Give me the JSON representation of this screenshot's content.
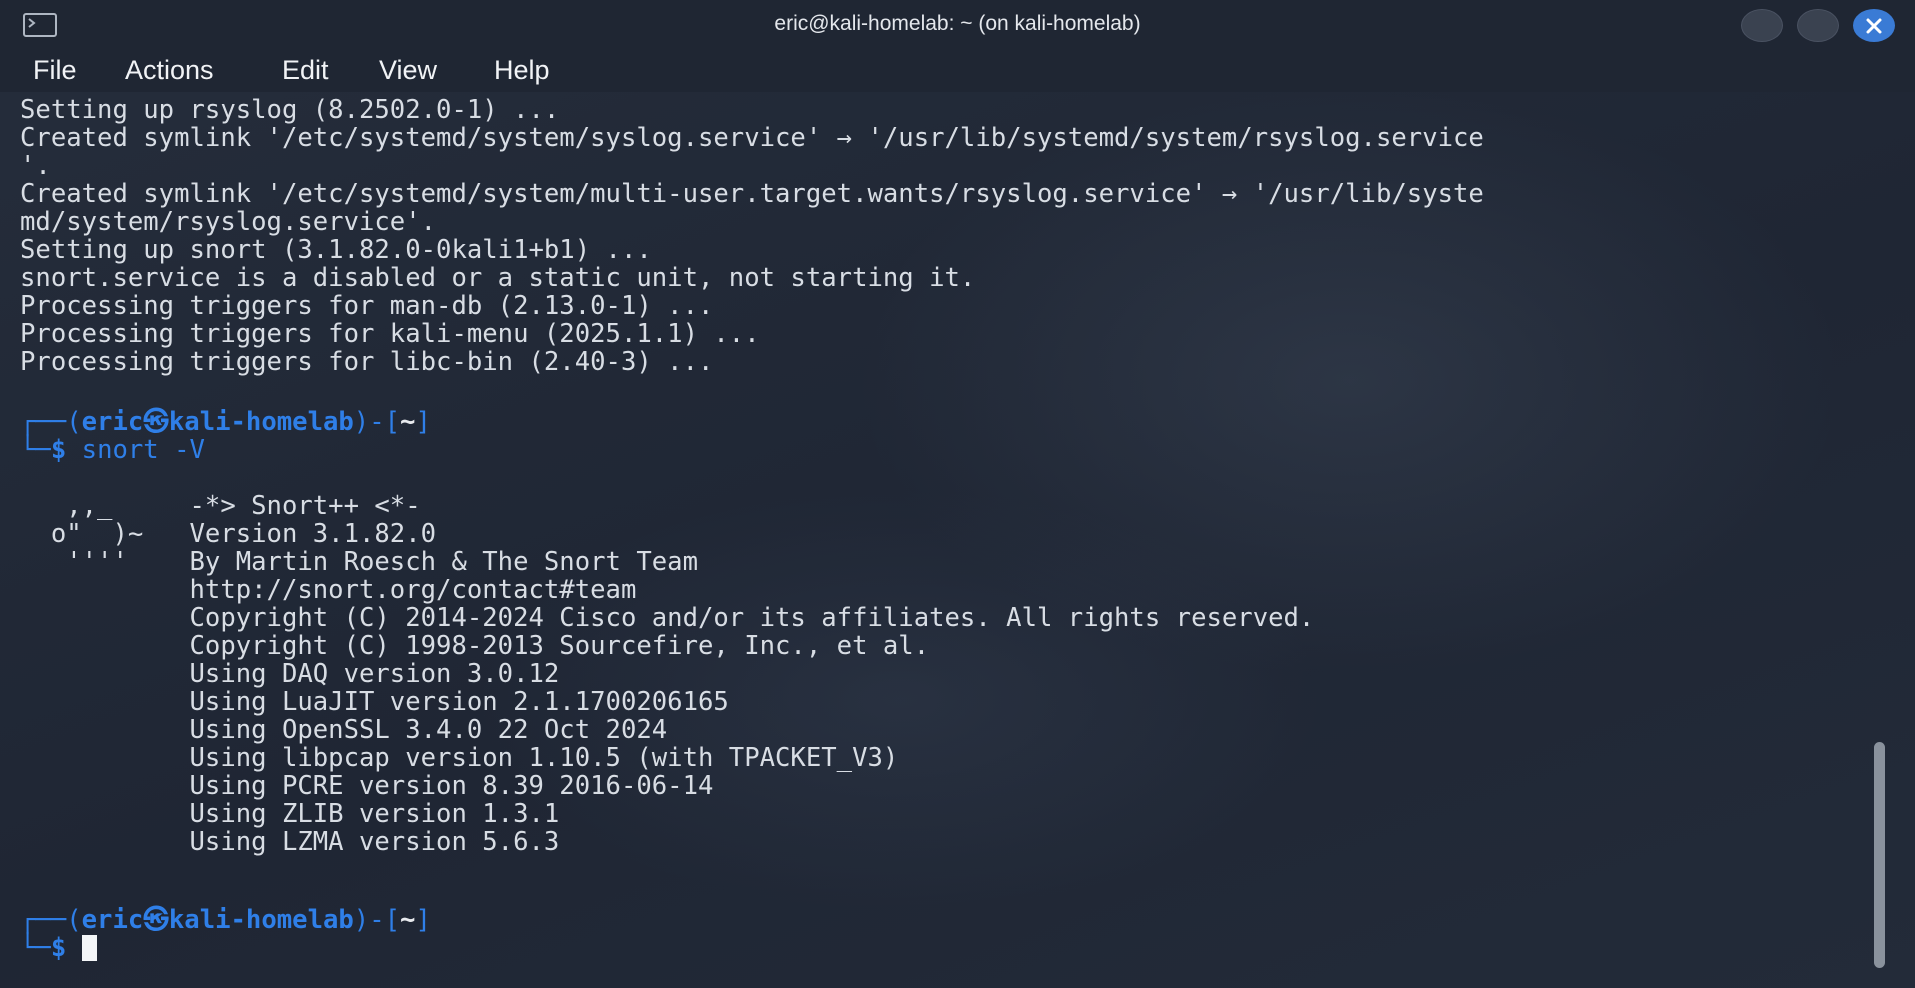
{
  "window": {
    "title": "eric@kali-homelab: ~ (on kali-homelab)",
    "accent_color": "#3a7bd5"
  },
  "menu": {
    "items": [
      "File",
      "Actions",
      "Edit",
      "View",
      "Help"
    ]
  },
  "terminal": {
    "lines": [
      "Setting up rsyslog (8.2502.0-1) ...",
      "Created symlink '/etc/systemd/system/syslog.service' → '/usr/lib/systemd/system/rsyslog.service",
      "'.",
      "Created symlink '/etc/systemd/system/multi-user.target.wants/rsyslog.service' → '/usr/lib/syste",
      "md/system/rsyslog.service'.",
      "Setting up snort (3.1.82.0-0kali1+b1) ...",
      "snort.service is a disabled or a static unit, not starting it.",
      "Processing triggers for man-db (2.13.0-1) ...",
      "Processing triggers for kali-menu (2025.1.1) ...",
      "Processing triggers for libc-bin (2.40-3) ..."
    ],
    "prompt1": {
      "open": "┌──(",
      "user": "eric",
      "at": "㉿",
      "host": "kali-homelab",
      "close": ")-[",
      "cwd": "~",
      "end": "]",
      "prefix": "└─",
      "dollar": "$",
      "command": " snort -V"
    },
    "banner": [
      "   ,,_     -*> Snort++ <*-",
      "  o\"  )~   Version 3.1.82.0",
      "   ''''    By Martin Roesch & The Snort Team",
      "           http://snort.org/contact#team",
      "           Copyright (C) 2014-2024 Cisco and/or its affiliates. All rights reserved.",
      "           Copyright (C) 1998-2013 Sourcefire, Inc., et al.",
      "           Using DAQ version 3.0.12",
      "           Using LuaJIT version 2.1.1700206165",
      "           Using OpenSSL 3.4.0 22 Oct 2024",
      "           Using libpcap version 1.10.5 (with TPACKET_V3)",
      "           Using PCRE version 8.39 2016-06-14",
      "           Using ZLIB version 1.3.1",
      "           Using LZMA version 5.6.3"
    ],
    "prompt2": {
      "open": "┌──(",
      "user": "eric",
      "at": "㉿",
      "host": "kali-homelab",
      "close": ")-[",
      "cwd": "~",
      "end": "]",
      "prefix": "└─",
      "dollar": "$"
    }
  },
  "icons": {
    "terminal": "terminal-icon",
    "minimize": "minimize-icon",
    "maximize": "maximize-icon",
    "close": "close-icon"
  }
}
